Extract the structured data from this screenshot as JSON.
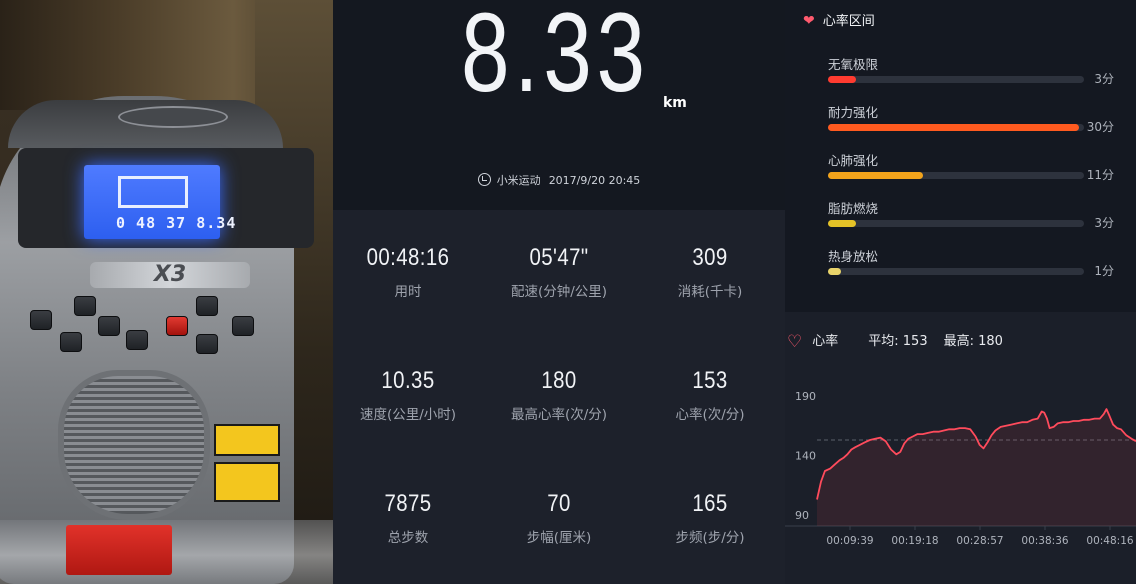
{
  "colors": {
    "zone_anaerobic": "#ff3b30",
    "zone_endurance": "#ff5a1f",
    "zone_cardio": "#f2a31b",
    "zone_fatburn": "#e4c227",
    "zone_warmup": "#e8d36a",
    "hr_line": "#ff4b5c",
    "heart_icon": "#ff5a6e"
  },
  "photo": {
    "lcd_digits": "0 48 37 8.34"
  },
  "summary": {
    "distance": "8.33",
    "unit": "km",
    "source_icon": "mi-logo-icon",
    "source_name": "小米运动",
    "source_date": "2017/9/20 20:45"
  },
  "stats": [
    {
      "value": "00:48:16",
      "label": "用时"
    },
    {
      "value": "05'47\"",
      "label": "配速(分钟/公里)"
    },
    {
      "value": "309",
      "label": "消耗(千卡)"
    },
    {
      "value": "10.35",
      "label": "速度(公里/小时)"
    },
    {
      "value": "180",
      "label": "最高心率(次/分)"
    },
    {
      "value": "153",
      "label": "心率(次/分)"
    },
    {
      "value": "7875",
      "label": "总步数"
    },
    {
      "value": "70",
      "label": "步幅(厘米)"
    },
    {
      "value": "165",
      "label": "步频(步/分)"
    }
  ],
  "zones": {
    "title": "心率区间",
    "icon": "heart-icon",
    "items": [
      {
        "name": "无氧极限",
        "minutes": "3分",
        "fraction": 0.11
      },
      {
        "name": "耐力强化",
        "minutes": "30分",
        "fraction": 0.98
      },
      {
        "name": "心肺强化",
        "minutes": "11分",
        "fraction": 0.37
      },
      {
        "name": "脂肪燃烧",
        "minutes": "3分",
        "fraction": 0.11
      },
      {
        "name": "热身放松",
        "minutes": "1分",
        "fraction": 0.05
      }
    ]
  },
  "heart_rate": {
    "title": "心率",
    "avg": "平均: 153",
    "max": "最高: 180"
  },
  "chart_data": {
    "type": "line",
    "y_ticks": [
      "190",
      "140",
      "90"
    ],
    "x_ticks": [
      "00:09:39",
      "00:19:18",
      "00:28:57",
      "00:38:36",
      "00:48:16"
    ],
    "ylim": [
      90,
      190
    ],
    "xlim_minutes": [
      0,
      48.27
    ],
    "avg_line": 153,
    "series": [
      {
        "x_minutes": [
          0,
          0.6,
          1.2,
          2.0,
          2.8,
          3.4,
          4.0,
          4.6,
          5.2,
          5.8,
          6.5,
          7.2,
          8.0,
          8.8,
          9.6,
          10.4,
          11.2,
          12.0,
          12.6,
          13.2,
          13.8,
          14.5,
          15.2,
          16.0,
          16.8,
          17.6,
          18.4,
          19.2,
          20.0,
          20.8,
          21.6,
          22.4,
          23.2,
          24.0,
          24.6,
          25.2,
          25.8,
          26.4,
          27.0,
          27.8,
          28.6,
          29.4,
          30.2,
          31.0,
          31.8,
          32.6,
          33.4,
          34.0,
          34.4,
          34.8,
          35.2,
          35.8,
          36.4,
          37.2,
          38.0,
          38.8,
          39.6,
          40.4,
          41.2,
          42.0,
          42.8,
          43.4,
          43.8,
          44.2,
          44.8,
          45.4,
          46.0,
          46.8,
          47.6,
          48.27
        ],
        "y": [
          103,
          118,
          127,
          129,
          133,
          136,
          138,
          141,
          145,
          147,
          149,
          151,
          153,
          154,
          155,
          152,
          145,
          141,
          143,
          150,
          154,
          156,
          158,
          158,
          159,
          160,
          160,
          161,
          162,
          162,
          163,
          163,
          162,
          156,
          149,
          146,
          151,
          157,
          161,
          164,
          165,
          166,
          167,
          168,
          168,
          170,
          171,
          177,
          176,
          171,
          163,
          164,
          167,
          168,
          168,
          169,
          169,
          170,
          170,
          171,
          171,
          175,
          179,
          174,
          166,
          163,
          162,
          157,
          154,
          152
        ]
      }
    ]
  }
}
